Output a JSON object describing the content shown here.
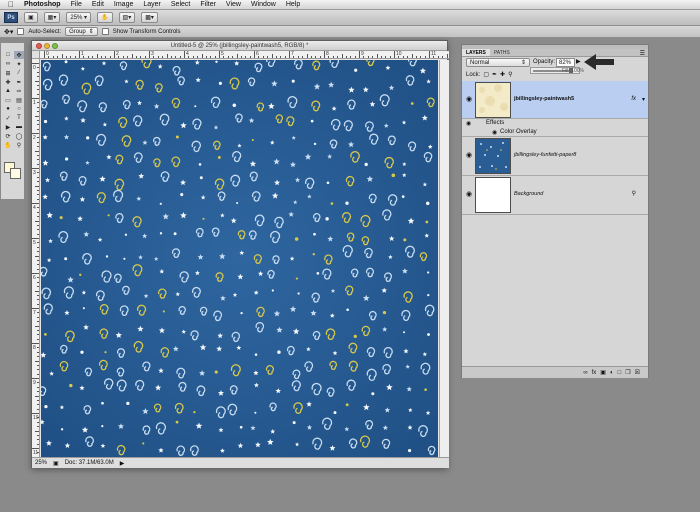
{
  "menubar": {
    "apple": "",
    "app_name": "Photoshop",
    "items": [
      "File",
      "Edit",
      "Image",
      "Layer",
      "Select",
      "Filter",
      "View",
      "Window",
      "Help"
    ]
  },
  "appbar": {
    "logo": "Ps",
    "zoom": "25%"
  },
  "options": {
    "auto_select_label": "Auto-Select:",
    "auto_select_value": "Group",
    "transform_label": "Show Transform Controls"
  },
  "document": {
    "title": "Untitled-5 @ 25% (jbillingsley-paintwash5, RGB/8) *",
    "status_zoom": "25%",
    "status_doc": "Doc: 37.1M/63.0M",
    "ruler_top_labels": [
      "0",
      "1",
      "2",
      "3",
      "4",
      "5",
      "6",
      "7",
      "8",
      "9",
      "10",
      "11"
    ],
    "ruler_left_labels": [
      "0",
      "1",
      "2",
      "3",
      "4",
      "5",
      "6",
      "7",
      "8",
      "9",
      "10",
      "11"
    ],
    "pattern_colors": {
      "background": "#2a5d94",
      "swirl_light": "#c8ddf2",
      "swirl_yellow": "#d9c94b",
      "star": "#f4f7fb"
    }
  },
  "layers_panel": {
    "tabs": [
      "LAYERS",
      "PATHS"
    ],
    "blend_mode": "Normal",
    "opacity_label": "Opacity:",
    "opacity_value": "82%",
    "fill_label": "Fill: 100%",
    "lock_label": "Lock:",
    "opacity_fraction": 0.82,
    "layers": [
      {
        "name": "jbillingsley-paintwash5",
        "selected": true,
        "fx": "fx"
      },
      {
        "name": "jbillingsley-funfetti-paper8",
        "selected": false
      },
      {
        "name": "Background",
        "selected": false,
        "locked": true
      }
    ],
    "effects_label": "Effects",
    "color_overlay_label": "Color Overlay"
  }
}
